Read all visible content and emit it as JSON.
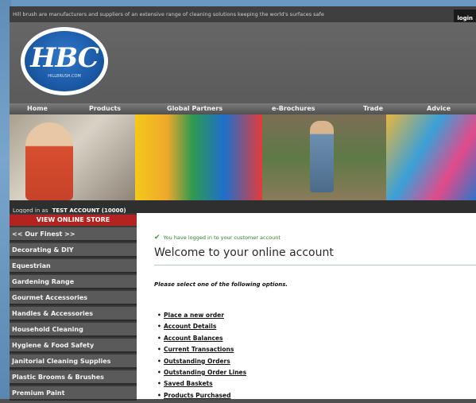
{
  "tagline": "Hill brush are manufacturers and suppliers of an extensive range of cleaning solutions keeping the world's surfaces safe",
  "login_link": "login",
  "logo": {
    "text": "HBC",
    "url": "HILLBRUSH.COM"
  },
  "nav": [
    "Home",
    "Products",
    "Global Partners",
    "e-Brochures",
    "Trade",
    "Advice"
  ],
  "login_status": {
    "prefix": "Logged in as",
    "account": "TEST ACCOUNT (10000)"
  },
  "sidebar": {
    "store_button": "VIEW ONLINE STORE",
    "items": [
      "<< Our Finest >>",
      "Decorating & DIY",
      "Equestrian",
      "Gardening Range",
      "Gourmet Accessories",
      "Handles & Accessories",
      "Household Cleaning",
      "Hygiene & Food Safety",
      "Janitorial Cleaning Supplies",
      "Plastic Brooms & Brushes",
      "Premium Paint"
    ]
  },
  "content": {
    "success": "You have logged in to your customer account",
    "welcome": "Welcome to your online account",
    "instruction": "Please select one of the following options.",
    "options": [
      "Place a new order",
      "Account Details",
      "Account Balances",
      "Current Transactions",
      "Outstanding Orders",
      "Outstanding Order Lines",
      "Saved Baskets",
      "Products Purchased"
    ]
  },
  "colors": {
    "accent_red": "#b4231f",
    "nav_gray": "#505050",
    "logo_blue": "#1b5aa6"
  }
}
